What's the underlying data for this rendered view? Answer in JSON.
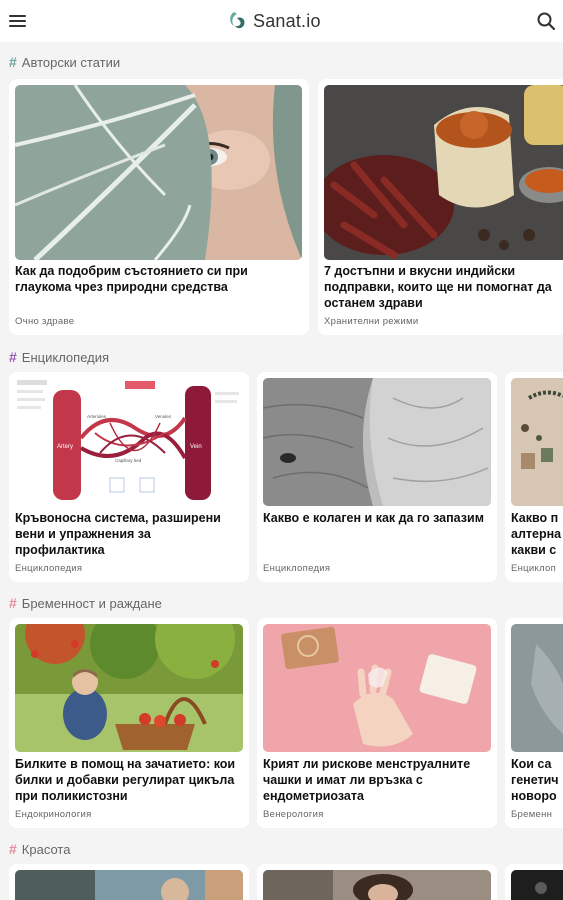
{
  "header": {
    "logo_text": "Sanat.io",
    "menu_icon": "hamburger-menu-icon",
    "search_icon": "search-icon",
    "logo_icon": "sanat-leaf-logo-icon"
  },
  "colors": {
    "hash_green": "#6aa39a",
    "hash_purple": "#9b59b6",
    "hash_pink": "#e58c9b"
  },
  "sections": [
    {
      "title": "Авторски статии",
      "hash": "#",
      "cards": [
        {
          "title": "Как да подобрим състоянието си при глаукома чрез природни средства",
          "category": "Очно здраве",
          "image": "woman eye behind green leaf"
        },
        {
          "title": "7 достъпни и вкусни индийски подправки, които ще ни помогнат да останем здрави",
          "category": "Хранителни режими",
          "image": "indian spices and dried chili peppers"
        }
      ]
    },
    {
      "title": "Енциклопедия",
      "hash": "#",
      "cards": [
        {
          "title": "Кръвоносна система, разширени вени и упражнения за профилактика",
          "category": "Енциклопедия",
          "image": "artery and vein diagram",
          "diagram_labels": [
            "Artery",
            "Vein",
            "Capillary bed",
            "Arterioles",
            "Venules"
          ]
        },
        {
          "title": "Какво е колаген и как да го запазим",
          "category": "Енциклопедия",
          "image": "elephant skin close-up"
        },
        {
          "title": "Какво п алтерна какви с",
          "category": "Енциклоп",
          "image": "herbs and beads"
        }
      ]
    },
    {
      "title": "Бременност и раждане",
      "hash": "#",
      "cards": [
        {
          "title": "Билките в помощ на зачатието: кои билки и добавки регулират цикъла при поликистозни",
          "category": "Ендокринология",
          "image": "child with apple baskets in garden"
        },
        {
          "title": "Крият ли рискове менструалните чашки и имат ли връзка с ендометриозата",
          "category": "Венерология",
          "image": "hand holding menstrual cup on pink"
        },
        {
          "title": "Кои са генетич новоро",
          "category": "Бременн",
          "image": "grey fabric"
        }
      ]
    },
    {
      "title": "Красота",
      "hash": "#",
      "cards": [
        {
          "title": "",
          "category": "",
          "image": "person outdoors"
        },
        {
          "title": "",
          "category": "",
          "image": "woman with dark hair"
        },
        {
          "title": "",
          "category": "",
          "image": "dark photo"
        }
      ]
    }
  ]
}
